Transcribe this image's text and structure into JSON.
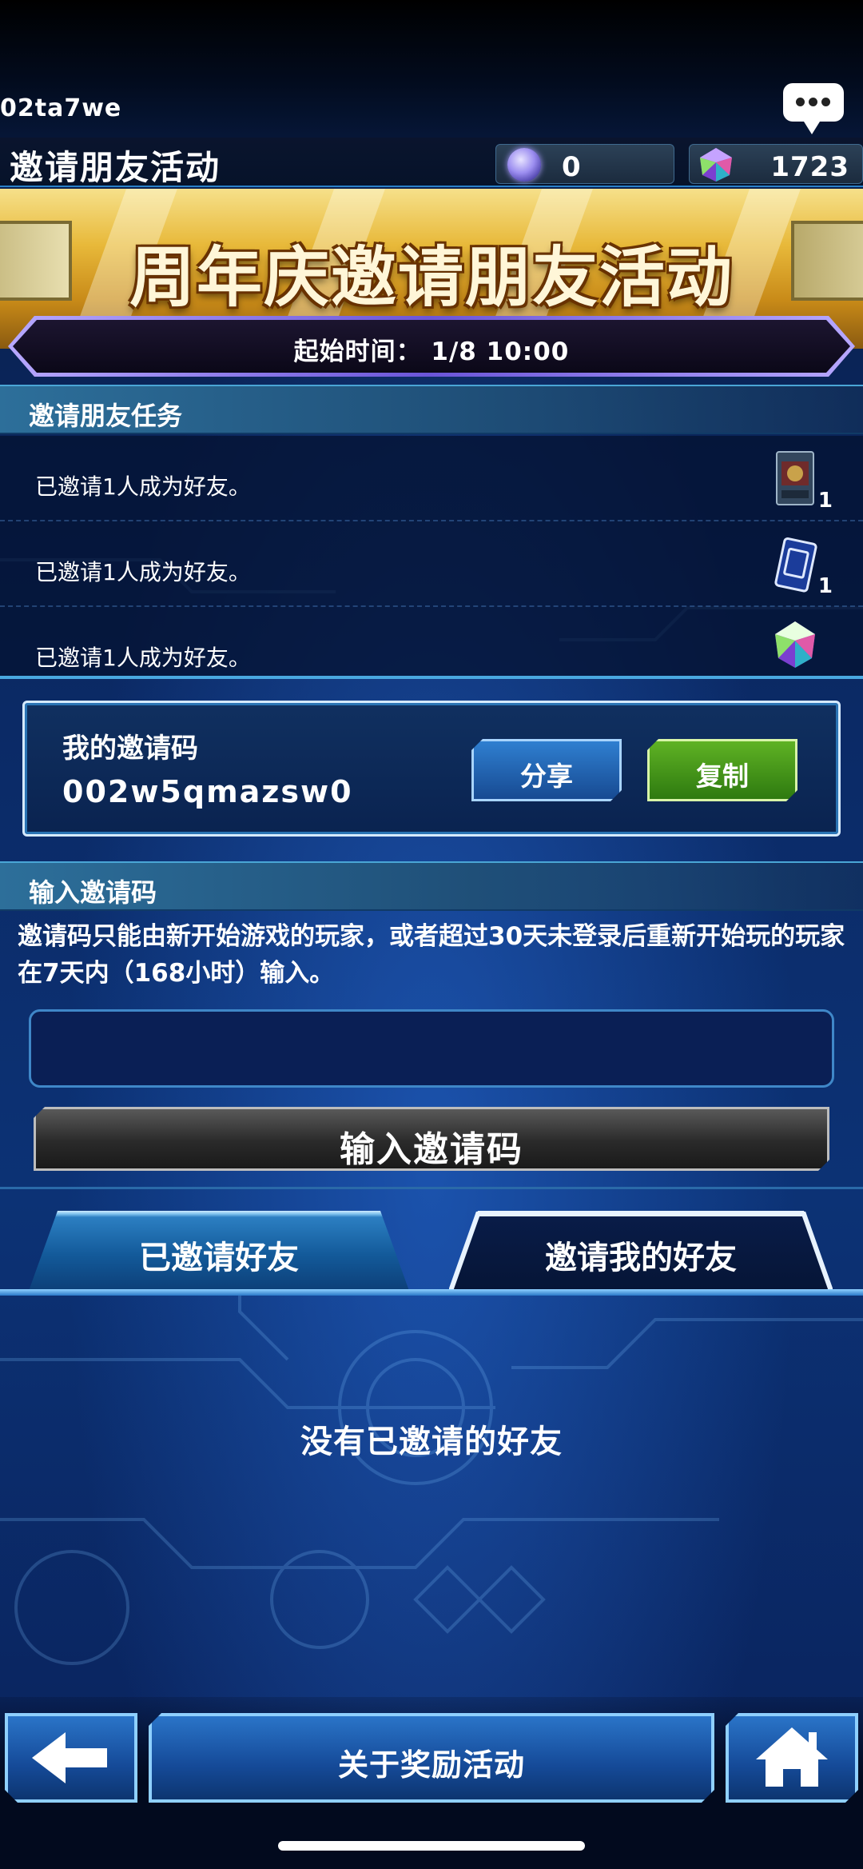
{
  "header": {
    "user_id": "02ta7we",
    "title": "邀请朋友活动",
    "currencies": [
      {
        "icon": "orb-icon",
        "value": "0"
      },
      {
        "icon": "gem-icon",
        "value": "1723"
      }
    ],
    "chat_icon": "chat-bubble-icon"
  },
  "banner": {
    "title": "周年庆邀请朋友活动",
    "start_time": "起始时间： 1/8 10:00"
  },
  "missions": {
    "header": "邀请朋友任务",
    "items": [
      {
        "text": "已邀请1人成为好友。",
        "reward_icon": "card-pack-icon",
        "count": "1"
      },
      {
        "text": "已邀请1人成为好友。",
        "reward_icon": "card-icon",
        "count": "1"
      },
      {
        "text": "已邀请1人成为好友。",
        "reward_icon": "gem-icon",
        "count": ""
      }
    ]
  },
  "my_code": {
    "label": "我的邀请码",
    "value": "002w5qmazsw0",
    "share_label": "分享",
    "copy_label": "复制"
  },
  "enter_code": {
    "header": "输入邀请码",
    "description": "邀请码只能由新开始游戏的玩家，或者超过30天未登录后重新开始玩的玩家在7天内（168小时）输入。",
    "input_value": "",
    "button_label": "输入邀请码"
  },
  "tabs": [
    {
      "label": "已邀请好友",
      "active": true
    },
    {
      "label": "邀请我的好友",
      "active": false
    }
  ],
  "empty_message": "没有已邀请的好友",
  "footer": {
    "back_icon": "arrow-left-icon",
    "about_label": "关于奖励活动",
    "home_icon": "home-icon"
  },
  "colors": {
    "accent_blue": "#2a74c8",
    "copy_green": "#5fb224",
    "banner_gold": "#e8b93a"
  }
}
